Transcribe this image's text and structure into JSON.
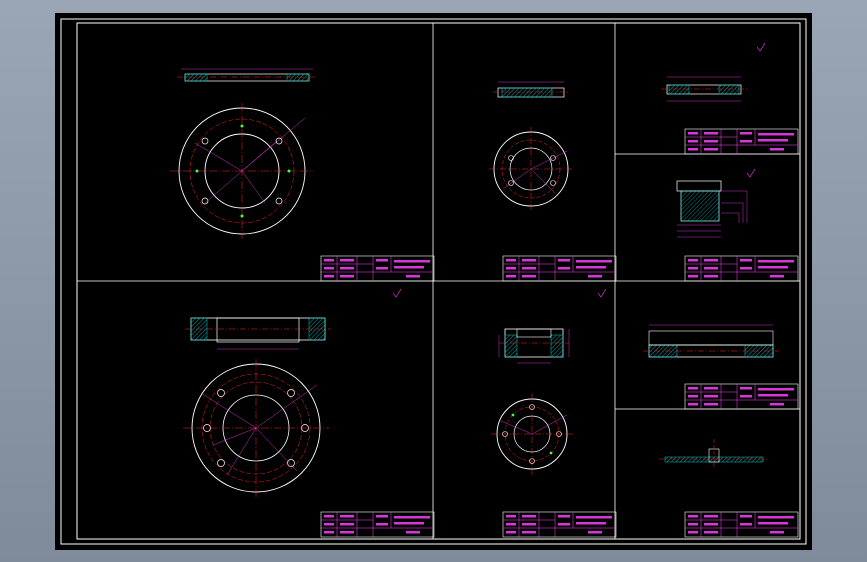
{
  "app": {
    "title": ""
  },
  "colors": {
    "background": "#000000",
    "frame": "#ffffff",
    "geometry": "#ffffff",
    "centerline": "#ff2020",
    "dimension": "#ff40ff",
    "hatch": "#00c8c8",
    "hole_marker": "#40ff40"
  },
  "title_blocks": [
    {
      "id": "a",
      "row1": "",
      "row2": "",
      "row3": ""
    },
    {
      "id": "b",
      "row1": "",
      "row2": "",
      "row3": ""
    },
    {
      "id": "c",
      "row1": "",
      "row2": "",
      "row3": ""
    },
    {
      "id": "d",
      "row1": "",
      "row2": "",
      "row3": ""
    },
    {
      "id": "e",
      "row1": "",
      "row2": "",
      "row3": ""
    },
    {
      "id": "f",
      "row1": "",
      "row2": "",
      "row3": ""
    },
    {
      "id": "g",
      "row1": "",
      "row2": "",
      "row3": ""
    },
    {
      "id": "h",
      "row1": "",
      "row2": "",
      "row3": ""
    }
  ],
  "roughness_marks": [
    "",
    "",
    "",
    "",
    ""
  ]
}
